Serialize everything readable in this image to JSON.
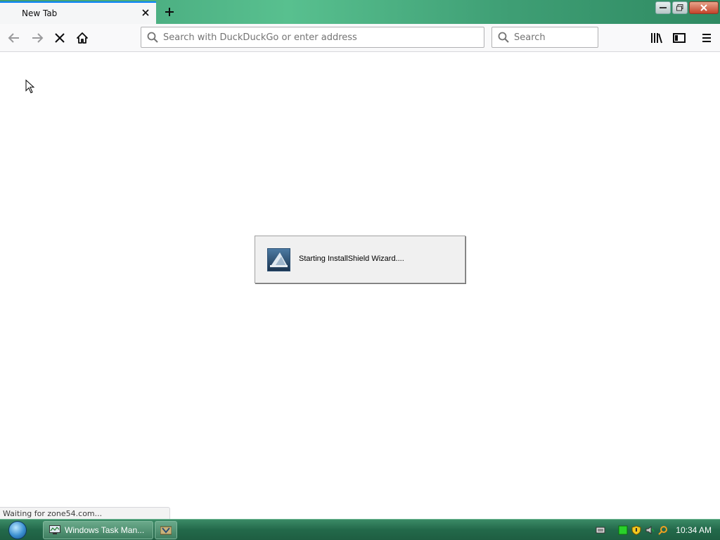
{
  "browser": {
    "tab": {
      "title": "New Tab"
    },
    "urlbar": {
      "placeholder": "Search with DuckDuckGo or enter address",
      "value": ""
    },
    "searchbar": {
      "placeholder": "Search",
      "value": ""
    },
    "status": "Waiting for zone54.com..."
  },
  "dialog": {
    "message": "Starting InstallShield Wizard...."
  },
  "taskbar": {
    "items": [
      {
        "label": "Windows Task Man...",
        "icon": "task-manager-icon"
      },
      {
        "label": "",
        "icon": "installer-icon"
      }
    ],
    "clock": "10:34 AM"
  },
  "colors": {
    "accent": "#0a84ff",
    "taskbar": "#2a7a56",
    "titlebar": "#4fb385"
  }
}
